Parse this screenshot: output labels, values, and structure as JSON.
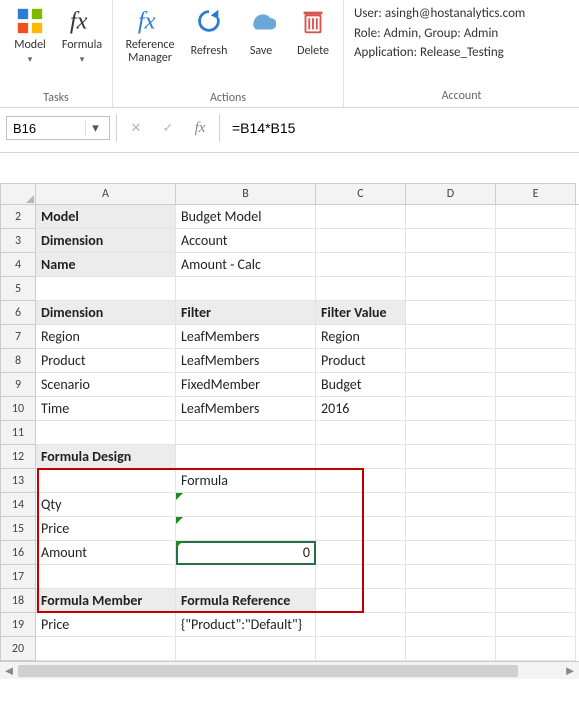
{
  "ribbon": {
    "tasks": {
      "label": "Tasks",
      "model": "Model",
      "formula": "Formula"
    },
    "actions": {
      "label": "Actions",
      "ref_mgr_l1": "Reference",
      "ref_mgr_l2": "Manager",
      "refresh": "Refresh",
      "save": "Save",
      "delete": "Delete"
    },
    "account": {
      "label": "Account",
      "user": "User: asingh@hostanalytics.com",
      "role": "Role: Admin, Group: Admin",
      "app": "Application: Release_Testing"
    }
  },
  "formula_bar": {
    "name_box": "B16",
    "formula": "=B14*B15"
  },
  "grid": {
    "columns": [
      "A",
      "B",
      "C",
      "D",
      "E"
    ],
    "rows": [
      {
        "n": "2",
        "a_b": true,
        "a": "Model",
        "b": "Budget Model",
        "c": "",
        "d": "",
        "e": "",
        "a_sh": true
      },
      {
        "n": "3",
        "a_b": true,
        "a": "Dimension",
        "b": "Account",
        "c": "",
        "d": "",
        "e": "",
        "a_sh": true
      },
      {
        "n": "4",
        "a_b": true,
        "a": "Name",
        "b": "Amount - Calc",
        "c": "",
        "d": "",
        "e": "",
        "a_sh": true
      },
      {
        "n": "5",
        "a": "",
        "b": "",
        "c": "",
        "d": "",
        "e": ""
      },
      {
        "n": "6",
        "a_b": true,
        "a": "Dimension",
        "b_b": true,
        "b": "Filter",
        "c_b": true,
        "c": "Filter Value",
        "d": "",
        "e": "",
        "a_sh": true,
        "b_sh": true,
        "c_sh": true
      },
      {
        "n": "7",
        "a": "Region",
        "b": "LeafMembers",
        "c": "Region",
        "d": "",
        "e": ""
      },
      {
        "n": "8",
        "a": "Product",
        "b": "LeafMembers",
        "c": "Product",
        "d": "",
        "e": ""
      },
      {
        "n": "9",
        "a": "Scenario",
        "b": "FixedMember",
        "c": "Budget",
        "d": "",
        "e": ""
      },
      {
        "n": "10",
        "a": "Time",
        "b": "LeafMembers",
        "c": "2016",
        "d": "",
        "e": ""
      },
      {
        "n": "11",
        "a": "",
        "b": "",
        "c": "",
        "d": "",
        "e": ""
      },
      {
        "n": "12",
        "a_b": true,
        "a": "Formula Design",
        "b": "",
        "c": "",
        "d": "",
        "e": "",
        "a_sh": true
      },
      {
        "n": "13",
        "a": "",
        "b": "Formula",
        "c": "",
        "d": "",
        "e": ""
      },
      {
        "n": "14",
        "a": "Qty",
        "b": "",
        "c": "",
        "d": "",
        "e": "",
        "b_mark": true
      },
      {
        "n": "15",
        "a": "Price",
        "b": "",
        "c": "",
        "d": "",
        "e": "",
        "b_mark": true
      },
      {
        "n": "16",
        "a": "Amount",
        "b": "0",
        "b_r": true,
        "c": "",
        "d": "",
        "e": "",
        "b_sel": true,
        "b_mark": true
      },
      {
        "n": "17",
        "a": "",
        "b": "",
        "c": "",
        "d": "",
        "e": ""
      },
      {
        "n": "18",
        "a_b": true,
        "a": "Formula Member",
        "b_b": true,
        "b": "Formula Reference",
        "c": "",
        "d": "",
        "e": "",
        "a_sh": true,
        "b_sh": true
      },
      {
        "n": "19",
        "a": "Price",
        "b": "{\"Product\":\"Default\"}",
        "c": "",
        "d": "",
        "e": ""
      },
      {
        "n": "20",
        "a": "",
        "b": "",
        "c": "",
        "d": "",
        "e": ""
      }
    ]
  }
}
